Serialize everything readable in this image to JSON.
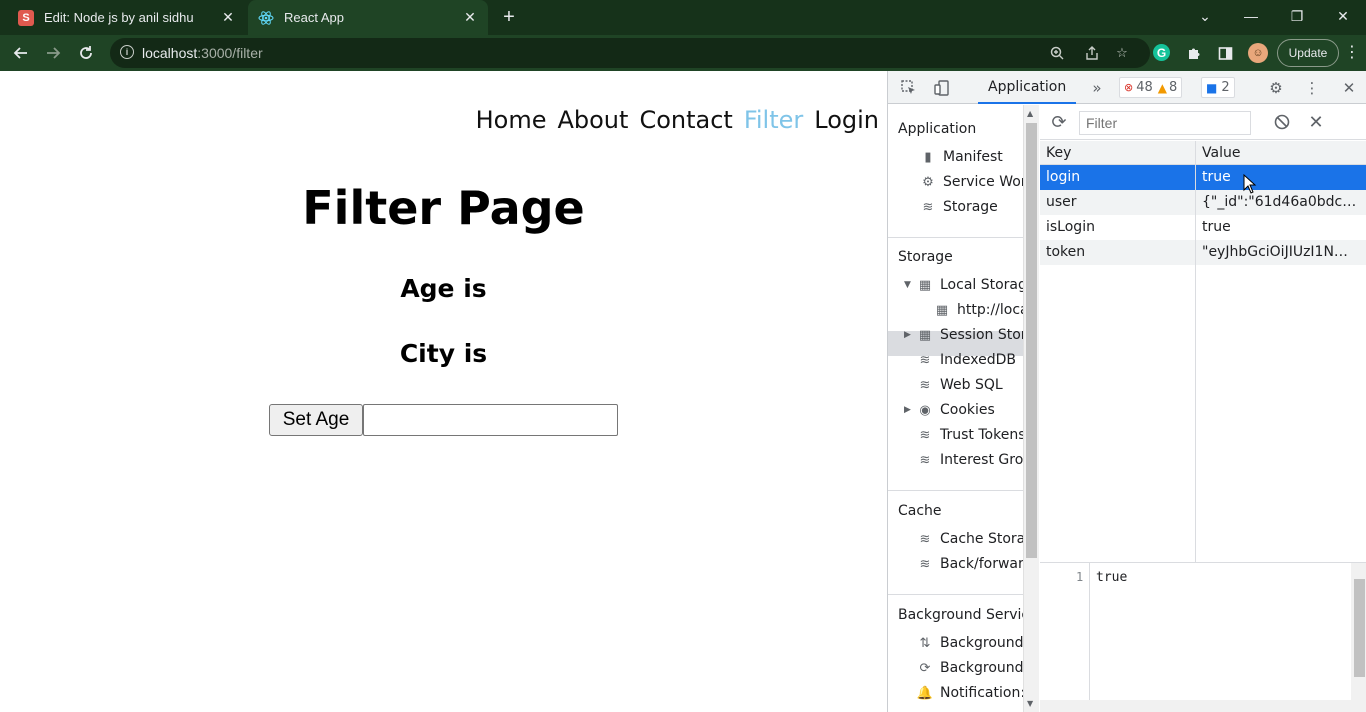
{
  "browser": {
    "tabs": [
      {
        "title": "Edit: Node js by anil sidhu",
        "favicon": "S",
        "favicon_color": "#e05a4f",
        "active": false
      },
      {
        "title": "React App",
        "favicon": "react-icon",
        "favicon_color": "#61dafb",
        "active": true
      }
    ],
    "new_tab": "+",
    "window_controls": {
      "dropdown": "⌄",
      "minimize": "—",
      "restore": "❐",
      "close": "✕"
    },
    "address": {
      "host": "localhost",
      "path": ":3000/filter"
    },
    "update_label": "Update",
    "extensions": {
      "grammarly": "G"
    }
  },
  "page": {
    "nav": [
      {
        "label": "Home",
        "active": false
      },
      {
        "label": "About",
        "active": false
      },
      {
        "label": "Contact",
        "active": false
      },
      {
        "label": "Filter",
        "active": true
      },
      {
        "label": "Login",
        "active": false
      }
    ],
    "title": "Filter Page",
    "age_text": "Age is",
    "city_text": "City is",
    "set_age_button": "Set Age",
    "age_input_value": ""
  },
  "devtools": {
    "active_tab": "Application",
    "more_tabs": "»",
    "errors_count": "48",
    "warnings_count": "8",
    "messages_count": "2",
    "sidebar": {
      "application_header": "Application",
      "application_items": [
        "Manifest",
        "Service Wor",
        "Storage"
      ],
      "storage_header": "Storage",
      "storage_items": {
        "local_storage": "Local Storag",
        "local_origin": "http://loca",
        "session_storage": "Session Stor",
        "indexeddb": "IndexedDB",
        "websql": "Web SQL",
        "cookies": "Cookies",
        "trust_tokens": "Trust Tokens",
        "interest_groups": "Interest Gro"
      },
      "cache_header": "Cache",
      "cache_items": [
        "Cache Stora",
        "Back/forwar"
      ],
      "background_header": "Background Servic",
      "background_items": [
        "Background",
        "Background",
        "Notification:"
      ]
    },
    "filter_placeholder": "Filter",
    "table": {
      "headers": [
        "Key",
        "Value"
      ],
      "rows": [
        {
          "key": "login",
          "value": "true"
        },
        {
          "key": "user",
          "value": "{\"_id\":\"61d46a0bdc…"
        },
        {
          "key": "isLogin",
          "value": "true"
        },
        {
          "key": "token",
          "value": "\"eyJhbGciOiJIUzI1N…"
        }
      ],
      "selected_row": 0
    },
    "preview": {
      "line_number": "1",
      "content": "true"
    }
  },
  "colors": {
    "tabstrip": "#16321a",
    "toolbar": "#1f4425",
    "nav_active": "#7fc4e8",
    "selection": "#1a73e8"
  }
}
